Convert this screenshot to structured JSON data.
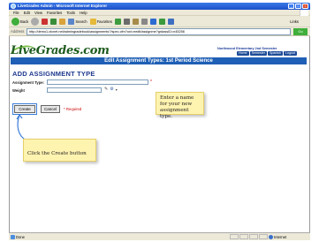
{
  "window": {
    "title": "LiveGrades Admin - Microsoft Internet Explorer"
  },
  "menubar": {
    "items": [
      "File",
      "Edit",
      "View",
      "Favorites",
      "Tools",
      "Help"
    ]
  },
  "toolbar": {
    "back_label": "Back",
    "search_label": "Search",
    "favorites_label": "Favorites",
    "links_label": "Links"
  },
  "addressbar": {
    "label": "Address",
    "url": "http://demo1.ctcnet.net/admingradebook/assignments?/spec.cfm?uni=eedit/assignme?grdassID=n45256",
    "go_label": "Go"
  },
  "site": {
    "logo": "LiveGrades.com",
    "school_name": "Northwood Elementary  2nd Semester",
    "nav": [
      "Home",
      "Semester",
      "Spanish",
      "Logout"
    ]
  },
  "page": {
    "banner": "Edit Assignment Types: 1st Period Science",
    "heading": "ADD ASSIGNMENT TYPE",
    "fields": {
      "type_label": "Assignment Type:",
      "type_value": "",
      "weight_label": "Weight",
      "weight_value": ""
    },
    "required_star": "*",
    "create_label": "Create",
    "cancel_label": "Cancel",
    "required_note": "* Required"
  },
  "callouts": {
    "name_hint": "Enter a name for your new assignment type.",
    "create_hint": "Click the Create button"
  },
  "statusbar": {
    "status": "Done",
    "zone": "Internet"
  },
  "colors": {
    "banner": "#1f5fb5",
    "heading": "#1f3a8f",
    "callout": "#fff3b0",
    "required": "#cc0000"
  }
}
